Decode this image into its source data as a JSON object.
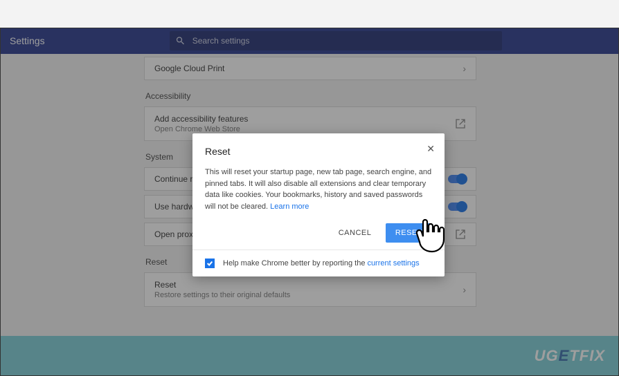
{
  "header": {
    "title": "Settings",
    "search_placeholder": "Search settings"
  },
  "rows": {
    "cloud_print": "Google Cloud Print",
    "accessibility_header": "Accessibility",
    "add_access_title": "Add accessibility features",
    "add_access_sub": "Open Chrome Web Store",
    "system_header": "System",
    "continue": "Continue running background apps when Google Chrome is closed",
    "hardware": "Use hardware acceleration when available",
    "proxy": "Open proxy settings",
    "reset_header": "Reset",
    "reset_title": "Reset",
    "reset_sub": "Restore settings to their original defaults"
  },
  "modal": {
    "title": "Reset",
    "body": "This will reset your startup page, new tab page, search engine, and pinned tabs. It will also disable all extensions and clear temporary data like cookies. Your bookmarks, history and saved passwords will not be cleared.",
    "learn_more": "Learn more",
    "cancel": "CANCEL",
    "reset": "RESET",
    "help_prefix": "Help make Chrome better by reporting the ",
    "help_link": "current settings"
  },
  "watermark": {
    "p1": "UG",
    "e": "E",
    "p2": "TFIX"
  }
}
